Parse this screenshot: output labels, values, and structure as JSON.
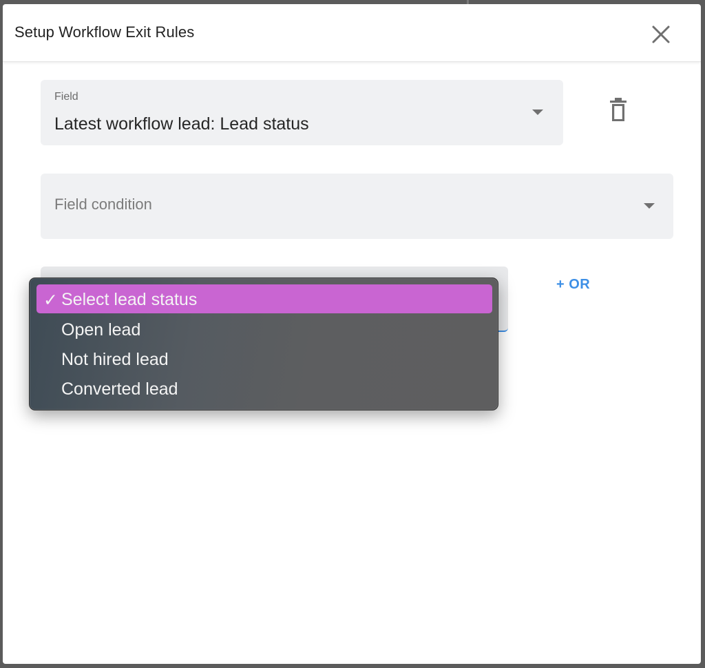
{
  "dialog": {
    "title": "Setup Workflow Exit Rules"
  },
  "field": {
    "label": "Field",
    "value": "Latest workflow lead: Lead status"
  },
  "field_condition": {
    "placeholder": "Field condition"
  },
  "actions": {
    "or_label": "+ OR"
  },
  "dropdown": {
    "check_mark": "✓",
    "options": [
      {
        "label": "Select lead status",
        "selected": true
      },
      {
        "label": "Open lead",
        "selected": false
      },
      {
        "label": "Not hired lead",
        "selected": false
      },
      {
        "label": "Converted lead",
        "selected": false
      }
    ]
  },
  "colors": {
    "accent": "#3d8fe6",
    "selected_option": "#c965d2",
    "field_background": "#f0f1f3"
  },
  "icons": {
    "close": "close-icon",
    "delete": "trash-icon",
    "dropdown": "caret-down-icon",
    "check": "check-icon"
  }
}
